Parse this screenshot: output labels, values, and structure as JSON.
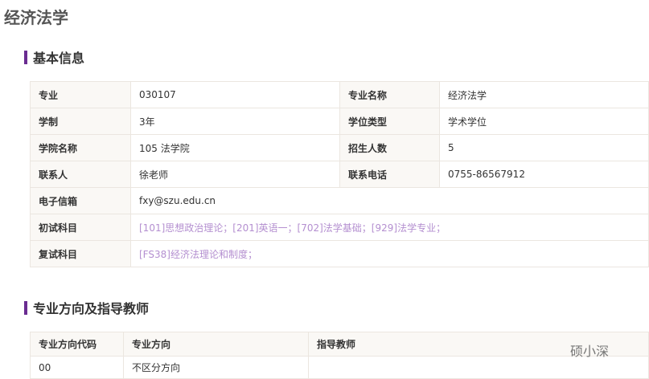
{
  "page_title": "经济法学",
  "section1": "基本信息",
  "info": {
    "major_label": "专业",
    "major": "030107",
    "major_name_label": "专业名称",
    "major_name": "经济法学",
    "years_label": "学制",
    "years": "3年",
    "degree_type_label": "学位类型",
    "degree_type": "学术学位",
    "college_label": "学院名称",
    "college": "105 法学院",
    "enroll_label": "招生人数",
    "enroll": "5",
    "contact_label": "联系人",
    "contact": "徐老师",
    "phone_label": "联系电话",
    "phone": "0755-86567912",
    "email_label": "电子信箱",
    "email": "fxy@szu.edu.cn",
    "initial_label": "初试科目",
    "initial": "[101]思想政治理论；[201]英语一；[702]法学基础；[929]法学专业；",
    "retest_label": "复试科目",
    "retest": "[FS38]经济法理论和制度；"
  },
  "section2": "专业方向及指导教师",
  "directions": {
    "headers": [
      "专业方向代码",
      "专业方向",
      "指导教师"
    ],
    "rows": [
      [
        "00",
        "不区分方向",
        ""
      ]
    ]
  },
  "watermark": "硕小深"
}
